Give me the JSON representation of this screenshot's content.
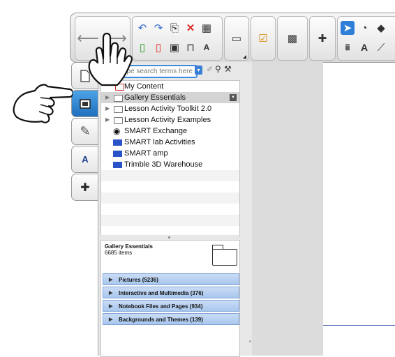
{
  "search": {
    "placeholder": "Type search terms here"
  },
  "tree": {
    "items": [
      {
        "label": "My Content",
        "icon": "content-icon",
        "expandable": false,
        "selected": false
      },
      {
        "label": "Gallery Essentials",
        "icon": "folder-icon",
        "expandable": true,
        "selected": true
      },
      {
        "label": "Lesson Activity Toolkit 2.0",
        "icon": "folder-icon",
        "expandable": true,
        "selected": false
      },
      {
        "label": "Lesson Activity Examples",
        "icon": "folder-icon",
        "expandable": true,
        "selected": false
      },
      {
        "label": "SMART Exchange",
        "icon": "globe-icon",
        "expandable": false,
        "selected": false
      },
      {
        "label": "SMART lab Activities",
        "icon": "smart-icon",
        "expandable": false,
        "selected": false
      },
      {
        "label": "SMART amp",
        "icon": "smart-icon",
        "expandable": false,
        "selected": false
      },
      {
        "label": "Trimble 3D Warehouse",
        "icon": "smart-icon",
        "expandable": false,
        "selected": false
      }
    ]
  },
  "details": {
    "title": "Gallery Essentials",
    "count": "6685 items",
    "categories": [
      {
        "label": "Pictures (5236)"
      },
      {
        "label": "Interactive and Multimedia (376)"
      },
      {
        "label": "Notebook Files and Pages (934)"
      },
      {
        "label": "Backgrounds and Themes (139)"
      }
    ]
  },
  "sidetabs": [
    {
      "name": "page-sorter",
      "icon": "page-icon",
      "active": false
    },
    {
      "name": "gallery",
      "icon": "gallery-icon",
      "active": true
    },
    {
      "name": "attachments",
      "icon": "paperclip-icon",
      "active": false
    },
    {
      "name": "properties",
      "icon": "properties-icon",
      "active": false
    },
    {
      "name": "addons",
      "icon": "puzzle-icon",
      "active": false
    }
  ],
  "colors": {
    "accent": "#2f7fd8",
    "selection": "#d4d4d4",
    "category_bg": "#b7d0f1"
  }
}
